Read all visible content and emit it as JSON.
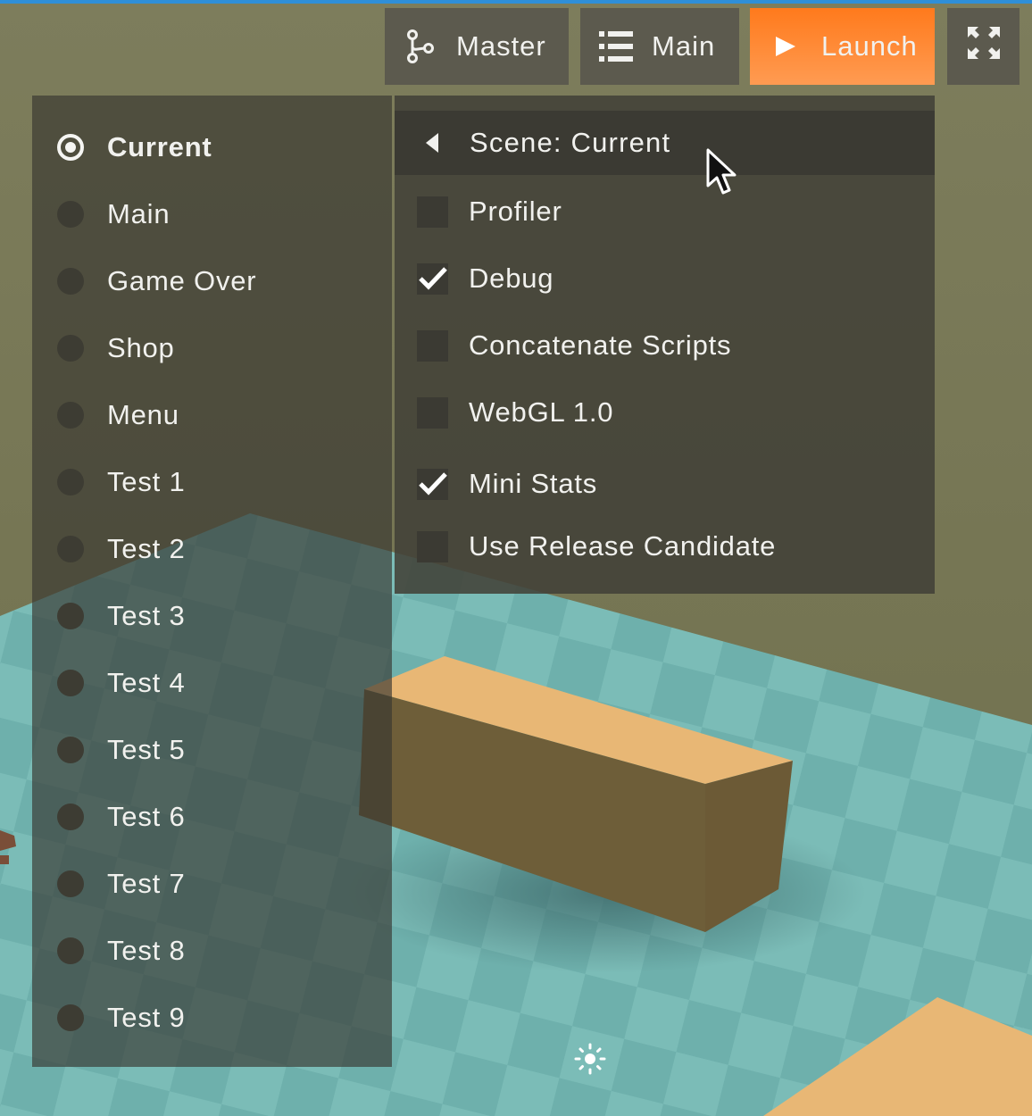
{
  "toolbar": {
    "branch_label": "Master",
    "scene_label": "Main",
    "launch_label": "Launch",
    "accent_color": "#ff8a33"
  },
  "scenes": {
    "items": [
      {
        "label": "Current",
        "selected": true
      },
      {
        "label": "Main"
      },
      {
        "label": "Game Over"
      },
      {
        "label": "Shop"
      },
      {
        "label": "Menu"
      },
      {
        "label": "Test 1"
      },
      {
        "label": "Test 2"
      },
      {
        "label": "Test 3"
      },
      {
        "label": "Test 4"
      },
      {
        "label": "Test 5"
      },
      {
        "label": "Test 6"
      },
      {
        "label": "Test 7"
      },
      {
        "label": "Test 8"
      },
      {
        "label": "Test 9"
      }
    ]
  },
  "options": {
    "header_label": "Scene: Current",
    "items": [
      {
        "label": "Profiler",
        "checked": false
      },
      {
        "label": "Debug",
        "checked": true
      },
      {
        "label": "Concatenate Scripts",
        "checked": false
      },
      {
        "label": "WebGL 1.0",
        "checked": false
      },
      {
        "label": "Mini Stats",
        "checked": true
      },
      {
        "label": "Use Release Candidate",
        "checked": false
      }
    ]
  },
  "icons": {
    "branch": "git-branch-icon",
    "scene": "list-icon",
    "launch": "play-icon",
    "expand": "fullscreen-icon",
    "back": "caret-left-icon",
    "check": "checkmark-icon",
    "loader": "loading-spinner-icon"
  }
}
